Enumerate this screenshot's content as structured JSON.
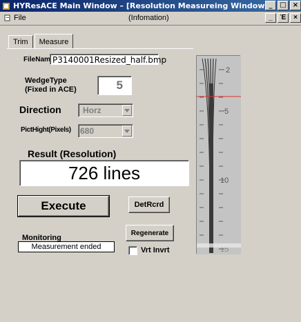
{
  "window": {
    "title": "HYResACE Main Window – [Resolution Measureing Window]",
    "min_glyph": "_",
    "max_glyph": "□",
    "close_glyph": "×"
  },
  "menu": {
    "file": "File",
    "info": "(Infomation)",
    "restore_glyph": "Έ",
    "min_glyph": "_",
    "close_glyph": "×"
  },
  "tabs": [
    {
      "label": "Trim",
      "active": false
    },
    {
      "label": "Measure",
      "active": true
    }
  ],
  "form": {
    "filename_label": "FileNam",
    "filename_value": "P3140001Resized_half.bmp",
    "wedge_label_1": "WedgeType",
    "wedge_label_2": "(Fixed in ACE)",
    "wedge_value": "5",
    "direction_label": "Direction",
    "direction_value": "Horz",
    "pict_label": "PictHight(Pixels)",
    "pict_value": "680",
    "result_label": "Result (Resolution)",
    "result_value": "726 lines",
    "execute_label": "Execute",
    "detrcrd_label": "DetRcrd",
    "regenerate_label": "Regenerate",
    "vrt_invrt_label": "Vrt Invrt",
    "monitoring_label": "Monitoring",
    "monitoring_value": "Measurement ended"
  },
  "gauge": {
    "tick_labels": [
      "2",
      "5",
      "10",
      "15"
    ],
    "accent_color": "#e0302a"
  }
}
